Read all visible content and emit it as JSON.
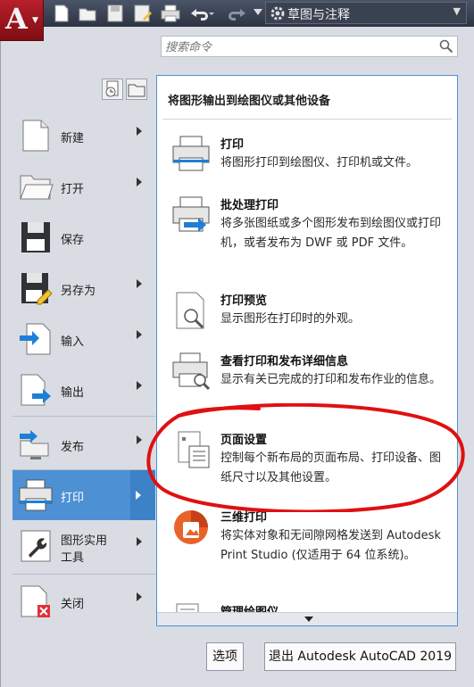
{
  "quick_access": {
    "app_letter": "A",
    "workspace": "草图与注释"
  },
  "search": {
    "placeholder": "搜索命令"
  },
  "commands": [
    {
      "label": "新建"
    },
    {
      "label": "打开"
    },
    {
      "label": "保存"
    },
    {
      "label": "另存为"
    },
    {
      "label": "输入"
    },
    {
      "label": "输出"
    },
    {
      "label": "发布"
    },
    {
      "label": "打印"
    },
    {
      "label_line1": "图形实用",
      "label_line2": "工具"
    },
    {
      "label": "关闭"
    }
  ],
  "submenu": {
    "title": "将图形输出到绘图仪或其他设备",
    "items": [
      {
        "title": "打印",
        "desc": "将图形打印到绘图仪、打印机或文件。"
      },
      {
        "title": "批处理打印",
        "desc": "将多张图纸或多个图形发布到绘图仪或打印机，或者发布为 DWF 或 PDF 文件。"
      },
      {
        "title": "打印预览",
        "desc": "显示图形在打印时的外观。"
      },
      {
        "title": "查看打印和发布详细信息",
        "desc": "显示有关已完成的打印和发布作业的信息。"
      },
      {
        "title": "页面设置",
        "desc": "控制每个新布局的页面布局、打印设备、图纸尺寸以及其他设置。"
      },
      {
        "title": "三维打印",
        "desc": "将实体对象和无间隙网格发送到 Autodesk Print Studio (仅适用于 64 位系统)。"
      },
      {
        "title": "管理绘图仪",
        "desc": ""
      }
    ]
  },
  "buttons": {
    "options": "选项",
    "exit": "退出 Autodesk AutoCAD 2019"
  },
  "colors": {
    "accent": "#4d91d4",
    "annotation": "#e01010",
    "app_red": "#b8202a"
  }
}
